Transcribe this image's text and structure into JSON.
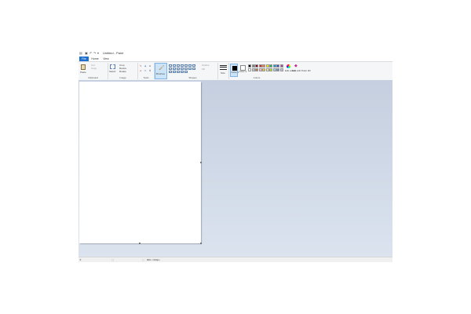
{
  "window": {
    "title": "Untitled - Paint",
    "quick_access_icons": [
      "save-icon",
      "undo-icon",
      "redo-icon",
      "customize-quick-access-icon"
    ]
  },
  "tabs": [
    {
      "label": "File",
      "active": true
    },
    {
      "label": "Home",
      "active": false
    },
    {
      "label": "View",
      "active": false
    }
  ],
  "ribbon": {
    "clipboard": {
      "label": "Clipboard",
      "paste": "Paste",
      "cut": "Cut",
      "copy": "Copy"
    },
    "image": {
      "label": "Image",
      "select": "Select",
      "crop": "Crop",
      "resize": "Resize",
      "rotate": "Rotate"
    },
    "tools": {
      "label": "Tools"
    },
    "brushes": {
      "label": "Brushes"
    },
    "shapes": {
      "label": "Shapes",
      "outline": "Outline",
      "fill": "Fill"
    },
    "size": {
      "label": "Size"
    },
    "colors": {
      "label": "Colors",
      "color1": "Color 1",
      "color2": "Color 2",
      "edit_colors": "Edit colors",
      "edit_with_paint3d": "Edit with Paint 3D",
      "palette_row1": [
        "#000000",
        "#7f7f7f",
        "#880015",
        "#ed1c24",
        "#ff7f27",
        "#fff200",
        "#22b14c",
        "#00a2e8",
        "#3f48cc",
        "#a349a4"
      ],
      "palette_row2": [
        "#ffffff",
        "#c3c3c3",
        "#b97a57",
        "#ffaec9",
        "#ffc90e",
        "#efe4b0",
        "#b5e61d",
        "#99d9ea",
        "#7092be",
        "#c8bfe7"
      ]
    }
  },
  "statusbar": {
    "canvas_size": "800 × 600px"
  },
  "colors": {
    "accent": "#1e6fcf",
    "workspace": "#cdd7e6"
  }
}
